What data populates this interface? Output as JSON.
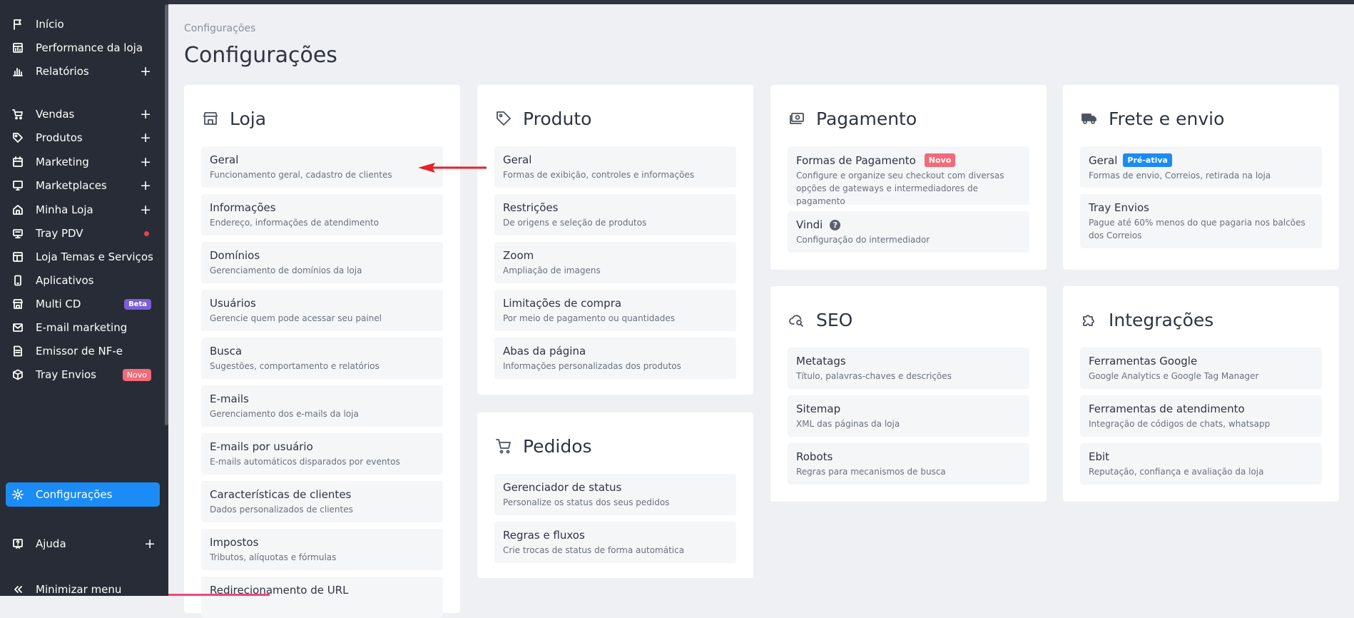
{
  "sidebar": {
    "items": [
      {
        "label": "Início",
        "icon": "flag-icon",
        "plus": ""
      },
      {
        "label": "Performance da loja",
        "icon": "chart-window-icon",
        "plus": ""
      },
      {
        "label": "Relatórios",
        "icon": "bar-chart-icon",
        "plus": "+"
      },
      {
        "label": "Vendas",
        "icon": "cart-icon",
        "plus": "+"
      },
      {
        "label": "Produtos",
        "icon": "tag-icon",
        "plus": "+"
      },
      {
        "label": "Marketing",
        "icon": "calendar-icon",
        "plus": "+"
      },
      {
        "label": "Marketplaces",
        "icon": "monitor-icon",
        "plus": "+"
      },
      {
        "label": "Minha Loja",
        "icon": "home-icon",
        "plus": "+"
      },
      {
        "label": "Tray PDV",
        "icon": "pos-icon",
        "plus": ""
      },
      {
        "label": "Loja Temas e Serviços",
        "icon": "layout-icon",
        "plus": ""
      },
      {
        "label": "Aplicativos",
        "icon": "phone-icon",
        "plus": ""
      },
      {
        "label": "Multi CD",
        "icon": "store-icon",
        "plus": "",
        "badge": "Beta"
      },
      {
        "label": "E-mail marketing",
        "icon": "mail-icon",
        "plus": ""
      },
      {
        "label": "Emissor de NF-e",
        "icon": "document-icon",
        "plus": ""
      },
      {
        "label": "Tray Envios",
        "icon": "box-icon",
        "plus": "",
        "badge": "Novo"
      },
      {
        "label": "Configurações",
        "icon": "gear-icon",
        "plus": ""
      },
      {
        "label": "Ajuda",
        "icon": "help-icon",
        "plus": "+"
      },
      {
        "label": "Minimizar menu",
        "icon": "double-chevron-left-icon",
        "plus": ""
      }
    ]
  },
  "breadcrumb": "Configurações",
  "title": "Configurações",
  "cards": {
    "loja": {
      "title": "Loja",
      "items": [
        {
          "t": "Geral",
          "d": "Funcionamento geral, cadastro de clientes"
        },
        {
          "t": "Informações",
          "d": "Endereço, informações de atendimento"
        },
        {
          "t": "Domínios",
          "d": "Gerenciamento de domínios da loja"
        },
        {
          "t": "Usuários",
          "d": "Gerencie quem pode acessar seu painel"
        },
        {
          "t": "Busca",
          "d": "Sugestões, comportamento e relatórios"
        },
        {
          "t": "E-mails",
          "d": "Gerenciamento dos e-mails da loja"
        },
        {
          "t": "E-mails por usuário",
          "d": "E-mails automáticos disparados por eventos"
        },
        {
          "t": "Características de clientes",
          "d": "Dados personalizados de clientes"
        },
        {
          "t": "Impostos",
          "d": "Tributos, alíquotas e fórmulas"
        },
        {
          "t": "Redirecionamento de URL",
          "d": ""
        }
      ]
    },
    "produto": {
      "title": "Produto",
      "items": [
        {
          "t": "Geral",
          "d": "Formas de exibição, controles e informações"
        },
        {
          "t": "Restrições",
          "d": "De origens e seleção de produtos"
        },
        {
          "t": "Zoom",
          "d": "Ampliação de imagens"
        },
        {
          "t": "Limitações de compra",
          "d": "Por meio de pagamento ou quantidades"
        },
        {
          "t": "Abas da página",
          "d": "Informações personalizadas dos produtos"
        }
      ]
    },
    "pedidos": {
      "title": "Pedidos",
      "items": [
        {
          "t": "Gerenciador de status",
          "d": "Personalize os status dos seus pedidos"
        },
        {
          "t": "Regras e fluxos",
          "d": "Crie trocas de status de forma automática"
        }
      ]
    },
    "pagamento": {
      "title": "Pagamento",
      "items": [
        {
          "t": "Formas de Pagamento",
          "badge": "Novo",
          "d": "Configure e organize seu checkout com diversas opções de gateways e intermediadores de pagamento"
        },
        {
          "t": "Vindi",
          "help": "?",
          "d": "Configuração do intermediador"
        }
      ]
    },
    "seo": {
      "title": "SEO",
      "items": [
        {
          "t": "Metatags",
          "d": "Título, palavras-chaves e descrições"
        },
        {
          "t": "Sitemap",
          "d": "XML das páginas da loja"
        },
        {
          "t": "Robots",
          "d": "Regras para mecanismos de busca"
        }
      ]
    },
    "frete": {
      "title": "Frete e envio",
      "items": [
        {
          "t": "Geral",
          "badge": "Pré-ativa",
          "d": "Formas de envio, Correios, retirada na loja"
        },
        {
          "t": "Tray Envios",
          "d": "Pague até 60% menos do que pagaria nos balcões dos Correios"
        }
      ]
    },
    "integracoes": {
      "title": "Integrações",
      "items": [
        {
          "t": "Ferramentas Google",
          "d": "Google Analytics e Google Tag Manager"
        },
        {
          "t": "Ferramentas de atendimento",
          "d": "Integração de códigos de chats, whatsapp"
        },
        {
          "t": "Ebit",
          "d": "Reputação, confiança e avaliação da loja"
        }
      ]
    }
  },
  "colors": {
    "sidebar_bg": "#272c36",
    "active": "#1b8bf5",
    "badge_novo": "#f26b7a",
    "badge_beta": "#7b5fd6",
    "arrow": "#e8202a"
  }
}
